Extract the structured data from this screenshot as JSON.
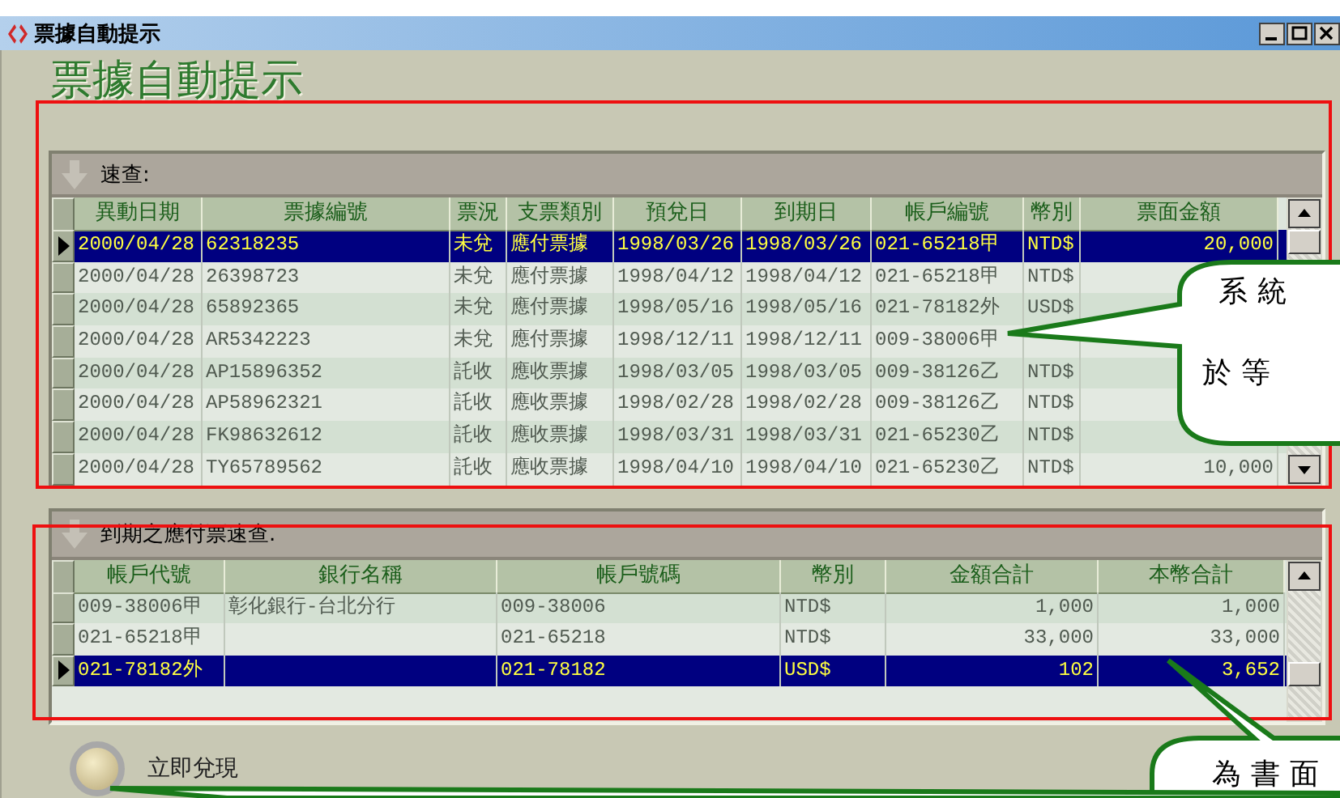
{
  "window": {
    "title": "票據自動提示"
  },
  "heading": "票據自動提示",
  "quick_panel": {
    "title": "速查:",
    "columns": [
      {
        "label": "異動日期",
        "kind": "text"
      },
      {
        "label": "票據編號",
        "kind": "text"
      },
      {
        "label": "票況",
        "kind": "text"
      },
      {
        "label": "支票類別",
        "kind": "text"
      },
      {
        "label": "預兌日",
        "kind": "text"
      },
      {
        "label": "到期日",
        "kind": "text"
      },
      {
        "label": "帳戶編號",
        "kind": "text"
      },
      {
        "label": "幣別",
        "kind": "text"
      },
      {
        "label": "票面金額",
        "kind": "amount"
      }
    ],
    "rows": [
      {
        "selected": true,
        "cells": [
          "2000/04/28",
          "62318235",
          "未兌",
          "應付票據",
          "1998/03/26",
          "1998/03/26",
          "021-65218甲",
          "NTD$",
          "20,000"
        ]
      },
      {
        "selected": false,
        "cells": [
          "2000/04/28",
          "26398723",
          "未兌",
          "應付票據",
          "1998/04/12",
          "1998/04/12",
          "021-65218甲",
          "NTD$"
        ]
      },
      {
        "selected": false,
        "cells": [
          "2000/04/28",
          "65892365",
          "未兌",
          "應付票據",
          "1998/05/16",
          "1998/05/16",
          "021-78182外",
          "USD$"
        ]
      },
      {
        "selected": false,
        "cells": [
          "2000/04/28",
          "AR5342223",
          "未兌",
          "應付票據",
          "1998/12/11",
          "1998/12/11",
          "009-38006甲"
        ]
      },
      {
        "selected": false,
        "cells": [
          "2000/04/28",
          "AP15896352",
          "託收",
          "應收票據",
          "1998/03/05",
          "1998/03/05",
          "009-38126乙",
          "NTD$"
        ]
      },
      {
        "selected": false,
        "cells": [
          "2000/04/28",
          "AP58962321",
          "託收",
          "應收票據",
          "1998/02/28",
          "1998/02/28",
          "009-38126乙",
          "NTD$"
        ]
      },
      {
        "selected": false,
        "cells": [
          "2000/04/28",
          "FK98632612",
          "託收",
          "應收票據",
          "1998/03/31",
          "1998/03/31",
          "021-65230乙",
          "NTD$"
        ]
      },
      {
        "selected": false,
        "cells": [
          "2000/04/28",
          "TY65789562",
          "託收",
          "應收票據",
          "1998/04/10",
          "1998/04/10",
          "021-65230乙",
          "NTD$",
          "10,000"
        ]
      }
    ]
  },
  "due_panel": {
    "title": "到期之應付票速查.",
    "columns": [
      {
        "label": "帳戶代號",
        "kind": "text"
      },
      {
        "label": "銀行名稱",
        "kind": "text"
      },
      {
        "label": "帳戶號碼",
        "kind": "text"
      },
      {
        "label": "幣別",
        "kind": "text"
      },
      {
        "label": "金額合計",
        "kind": "amount"
      },
      {
        "label": "本幣合計",
        "kind": "amount"
      }
    ],
    "rows": [
      {
        "selected": false,
        "cells": [
          "009-38006甲",
          "彰化銀行-台北分行",
          "009-38006",
          "NTD$",
          "1,000",
          "1,000"
        ]
      },
      {
        "selected": false,
        "cells": [
          "021-65218甲",
          "",
          "021-65218",
          "NTD$",
          "33,000",
          "33,000"
        ]
      },
      {
        "selected": true,
        "cells": [
          "021-78182外",
          "",
          "021-78182",
          "USD$",
          "102",
          "3,652"
        ]
      }
    ]
  },
  "cash_button": {
    "label": "立即兌現"
  },
  "callouts": [
    {
      "lines": [
        "系統",
        "於等"
      ]
    },
    {
      "lines": [
        "為書面"
      ]
    }
  ]
}
